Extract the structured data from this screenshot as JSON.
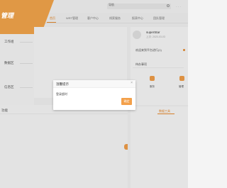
{
  "topbar": {
    "search_placeholder": "导航"
  },
  "brand": {
    "logo_text": "管理"
  },
  "nav": {
    "items": [
      {
        "label": "首页",
        "active": true
      },
      {
        "label": "WRT管理"
      },
      {
        "label": "客户中心"
      },
      {
        "label": "线索服务"
      },
      {
        "label": "报表中心"
      },
      {
        "label": "团队管理"
      }
    ]
  },
  "sidebar": {
    "items": [
      {
        "label": "工作组"
      },
      {
        "label": "数据区"
      },
      {
        "label": "信息区"
      }
    ]
  },
  "user": {
    "name": "superStar",
    "subtitle": "上次: 2020-03-03",
    "welcome": "欢迎来到平台进行(1)"
  },
  "tasks": {
    "title": "待办事项",
    "items": [
      {
        "label": "服务"
      },
      {
        "label": "管理"
      }
    ]
  },
  "lower": {
    "left_title": "功能",
    "right_title": "数据工具"
  },
  "dialog": {
    "title": "温馨提示",
    "message": "登录超时",
    "confirm_label": "确定",
    "close_glyph": "×"
  },
  "colors": {
    "accent": "#f3a04a",
    "brand": "#f7a84c"
  }
}
